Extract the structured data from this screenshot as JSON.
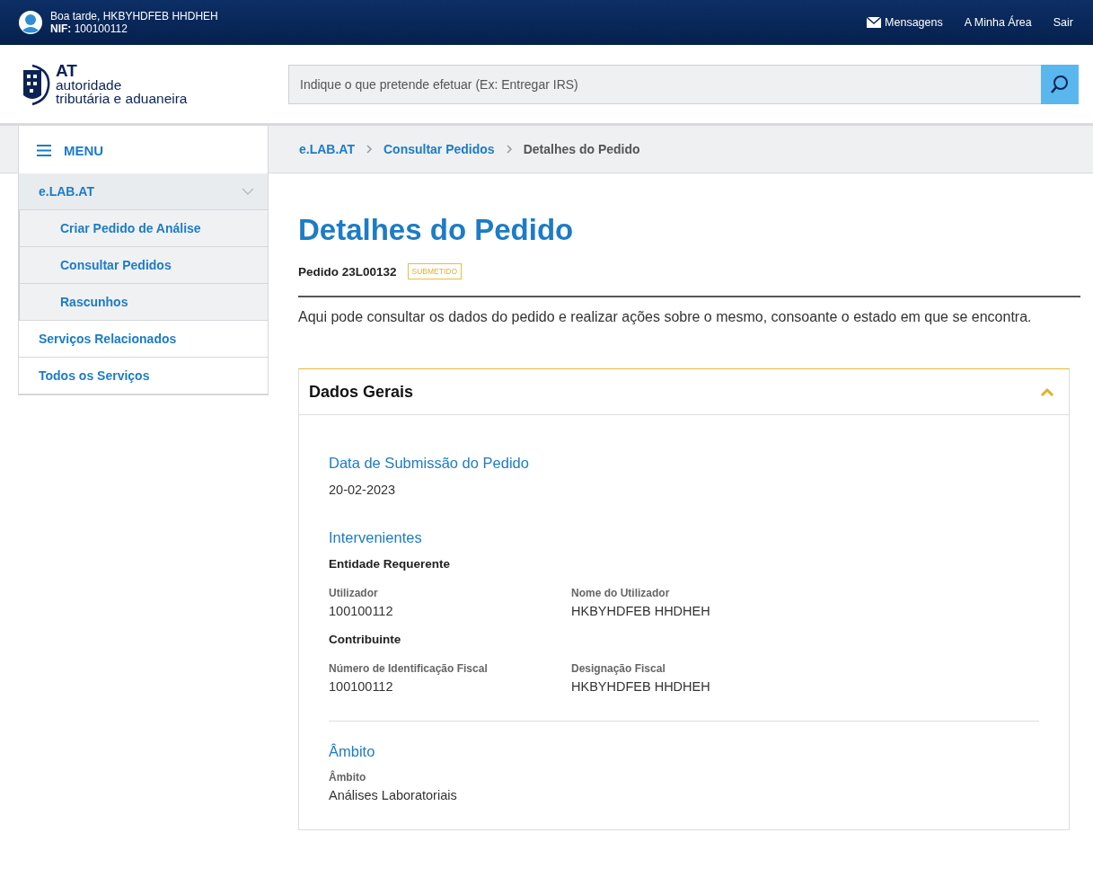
{
  "top_bar": {
    "greeting": "Boa tarde, HKBYHDFEB HHDHEH",
    "nif_label": "NIF:",
    "nif": "100100112",
    "links": [
      {
        "kind": "messages",
        "label": "Mensagens"
      },
      {
        "kind": "plain",
        "label": "A Minha Área"
      },
      {
        "kind": "plain",
        "label": "Sair"
      }
    ]
  },
  "logo": {
    "short": "AT",
    "line1": "autoridade",
    "line2": "tributária e aduaneira"
  },
  "search": {
    "placeholder": "Indique o que pretende efetuar (Ex: Entregar IRS)"
  },
  "menu": {
    "title": "MENU",
    "items": [
      {
        "label": "e.LAB.AT",
        "expanded": true,
        "children": [
          {
            "label": "Criar Pedido de Análise"
          },
          {
            "label": "Consultar Pedidos"
          },
          {
            "label": "Rascunhos"
          }
        ]
      },
      {
        "label": "Serviços Relacionados"
      },
      {
        "label": "Todos os Serviços"
      }
    ]
  },
  "breadcrumb": [
    {
      "label": "e.LAB.AT",
      "current": false
    },
    {
      "label": "Consultar Pedidos",
      "current": false
    },
    {
      "label": "Detalhes do Pedido",
      "current": true
    }
  ],
  "page": {
    "title": "Detalhes do Pedido",
    "order": "Pedido 23L00132",
    "status": "SUBMETIDO",
    "intro": "Aqui pode consultar os dados do pedido e realizar ações sobre o mesmo, consoante o estado em que se encontra."
  },
  "card": {
    "title": "Dados Gerais",
    "expanded": true,
    "sections": [
      {
        "heading": "Data de Submissão do Pedido",
        "blocks": [
          {
            "kind": "value",
            "text": "20-02-2023"
          }
        ]
      },
      {
        "heading": "Intervenientes",
        "blocks": [
          {
            "kind": "subheading",
            "text": "Entidade Requerente"
          },
          {
            "kind": "fields",
            "fields": [
              {
                "label": "Utilizador",
                "value": "100100112"
              },
              {
                "label": "Nome do Utilizador",
                "value": "HKBYHDFEB HHDHEH"
              }
            ]
          },
          {
            "kind": "subheading",
            "text": "Contribuinte"
          },
          {
            "kind": "fields",
            "fields": [
              {
                "label": "Número de Identificação Fiscal",
                "value": "100100112"
              },
              {
                "label": "Designação Fiscal",
                "value": "HKBYHDFEB HHDHEH"
              }
            ]
          }
        ]
      },
      {
        "heading": "Âmbito",
        "blocks": [
          {
            "kind": "fields",
            "fields": [
              {
                "label": "Âmbito",
                "value": "Análises Laboratoriais"
              }
            ]
          }
        ]
      }
    ]
  }
}
